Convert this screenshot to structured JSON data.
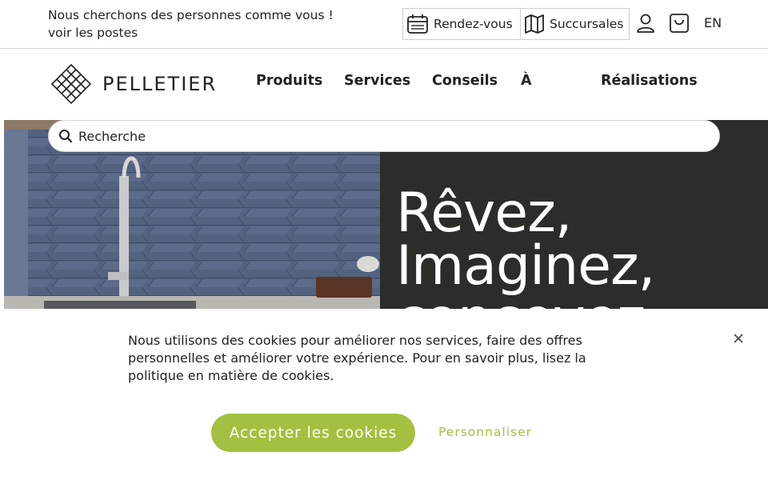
{
  "topbar": {
    "recruit_line1": "Nous cherchons des personnes comme vous !",
    "recruit_line2": "voir les postes",
    "appointments": "Rendez-vous",
    "branches": "Succursales",
    "lang": "EN"
  },
  "nav": {
    "logo_text": "PELLETIER",
    "items": [
      "Produits",
      "Services",
      "Conseils",
      "À",
      "Réalisations"
    ]
  },
  "search": {
    "placeholder": "Recherche"
  },
  "hero": {
    "line1": "Rêvez,",
    "line2": "Imaginez,",
    "line3": "concevez"
  },
  "cookie": {
    "text": "Nous utilisons des cookies pour améliorer nos services, faire des offres personnelles et améliorer votre expérience. Pour en savoir plus, lisez la politique en matière de cookies.",
    "accept": "Accepter les cookies",
    "customize": "Personnaliser"
  },
  "colors": {
    "accent": "#a4c040",
    "hero_dark": "#2b2d29"
  },
  "icons": [
    "calendar-icon",
    "map-icon",
    "user-icon",
    "cart-icon",
    "search-icon",
    "close-icon"
  ]
}
